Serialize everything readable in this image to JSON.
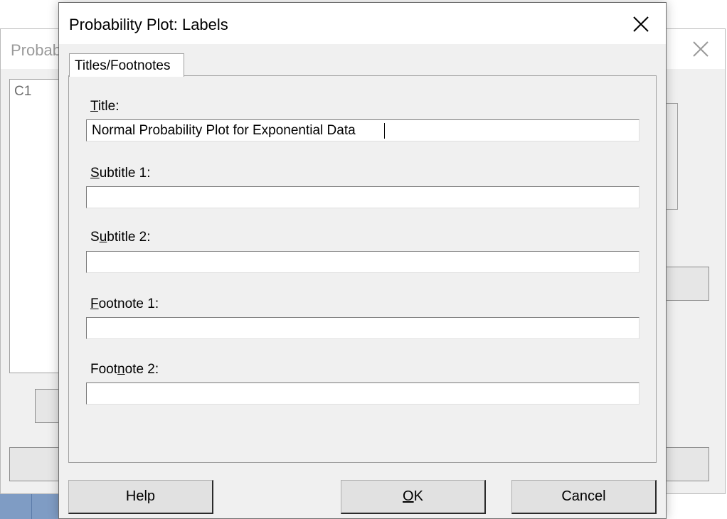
{
  "background_dialog": {
    "title": "Probab",
    "variables": [
      "C1"
    ]
  },
  "dialog": {
    "title": "Probability Plot: Labels",
    "tab": "Titles/Footnotes",
    "fields": {
      "title": {
        "label_pre": "",
        "label_accel": "T",
        "label_post": "itle:",
        "value": "Normal Probability Plot for Exponential Data"
      },
      "subtitle1": {
        "label_pre": "",
        "label_accel": "S",
        "label_post": "ubtitle 1:",
        "value": ""
      },
      "subtitle2": {
        "label_pre": "S",
        "label_accel": "u",
        "label_post": "btitle 2:",
        "value": ""
      },
      "footnote1": {
        "label_pre": "",
        "label_accel": "F",
        "label_post": "ootnote 1:",
        "value": ""
      },
      "footnote2": {
        "label_pre": "Foot",
        "label_accel": "n",
        "label_post": "ote 2:",
        "value": ""
      }
    },
    "buttons": {
      "help": "Help",
      "ok_accel": "O",
      "ok_rest": "K",
      "cancel": "Cancel"
    }
  },
  "icons": {
    "close": "close-icon"
  },
  "colors": {
    "dialog_bg": "#f0f0f0",
    "titlebar_bg": "#ffffff",
    "taskbar": "#7f9cc4"
  }
}
